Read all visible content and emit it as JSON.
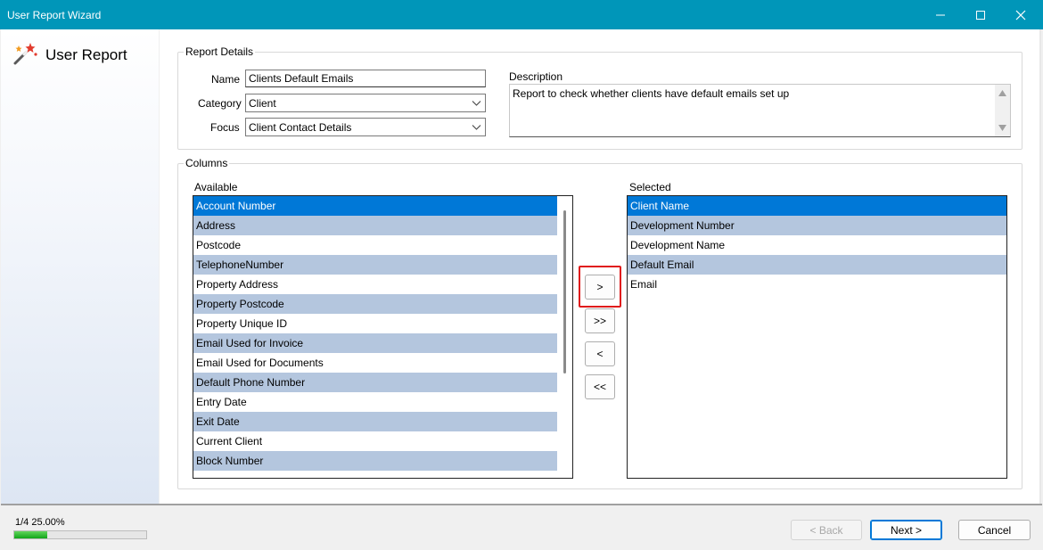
{
  "window": {
    "title": "User Report Wizard"
  },
  "sidebar": {
    "heading": "User Report",
    "icon": "magic-wand-icon"
  },
  "report_details": {
    "legend": "Report Details",
    "name_label": "Name",
    "name_value": "Clients Default Emails",
    "category_label": "Category",
    "category_value": "Client",
    "focus_label": "Focus",
    "focus_value": "Client Contact Details",
    "description_label": "Description",
    "description_value": "Report to check whether clients have default emails set up"
  },
  "columns": {
    "legend": "Columns",
    "available_label": "Available",
    "selected_label": "Selected",
    "available": [
      "Account Number",
      "Address",
      "Postcode",
      "TelephoneNumber",
      "Property Address",
      "Property Postcode",
      "Property Unique ID",
      "Email Used for Invoice",
      "Email Used for Documents",
      "Default Phone Number",
      "Entry Date",
      "Exit Date",
      "Current Client",
      "Block Number"
    ],
    "selected": [
      "Client Name",
      "Development Number",
      "Development Name",
      "Default Email",
      "Email"
    ],
    "buttons": {
      "add": ">",
      "add_all": ">>",
      "remove": "<",
      "remove_all": "<<"
    }
  },
  "footer": {
    "progress_text": "1/4 25.00%",
    "progress_fraction": 0.25,
    "back_label": "< Back",
    "next_label": "Next >",
    "cancel_label": "Cancel"
  },
  "colors": {
    "titlebar": "#0096b9",
    "selection": "#0078d7",
    "alt_row": "#b4c6de",
    "highlight_border": "#e01b1b",
    "progress_green": "#11a51a"
  }
}
